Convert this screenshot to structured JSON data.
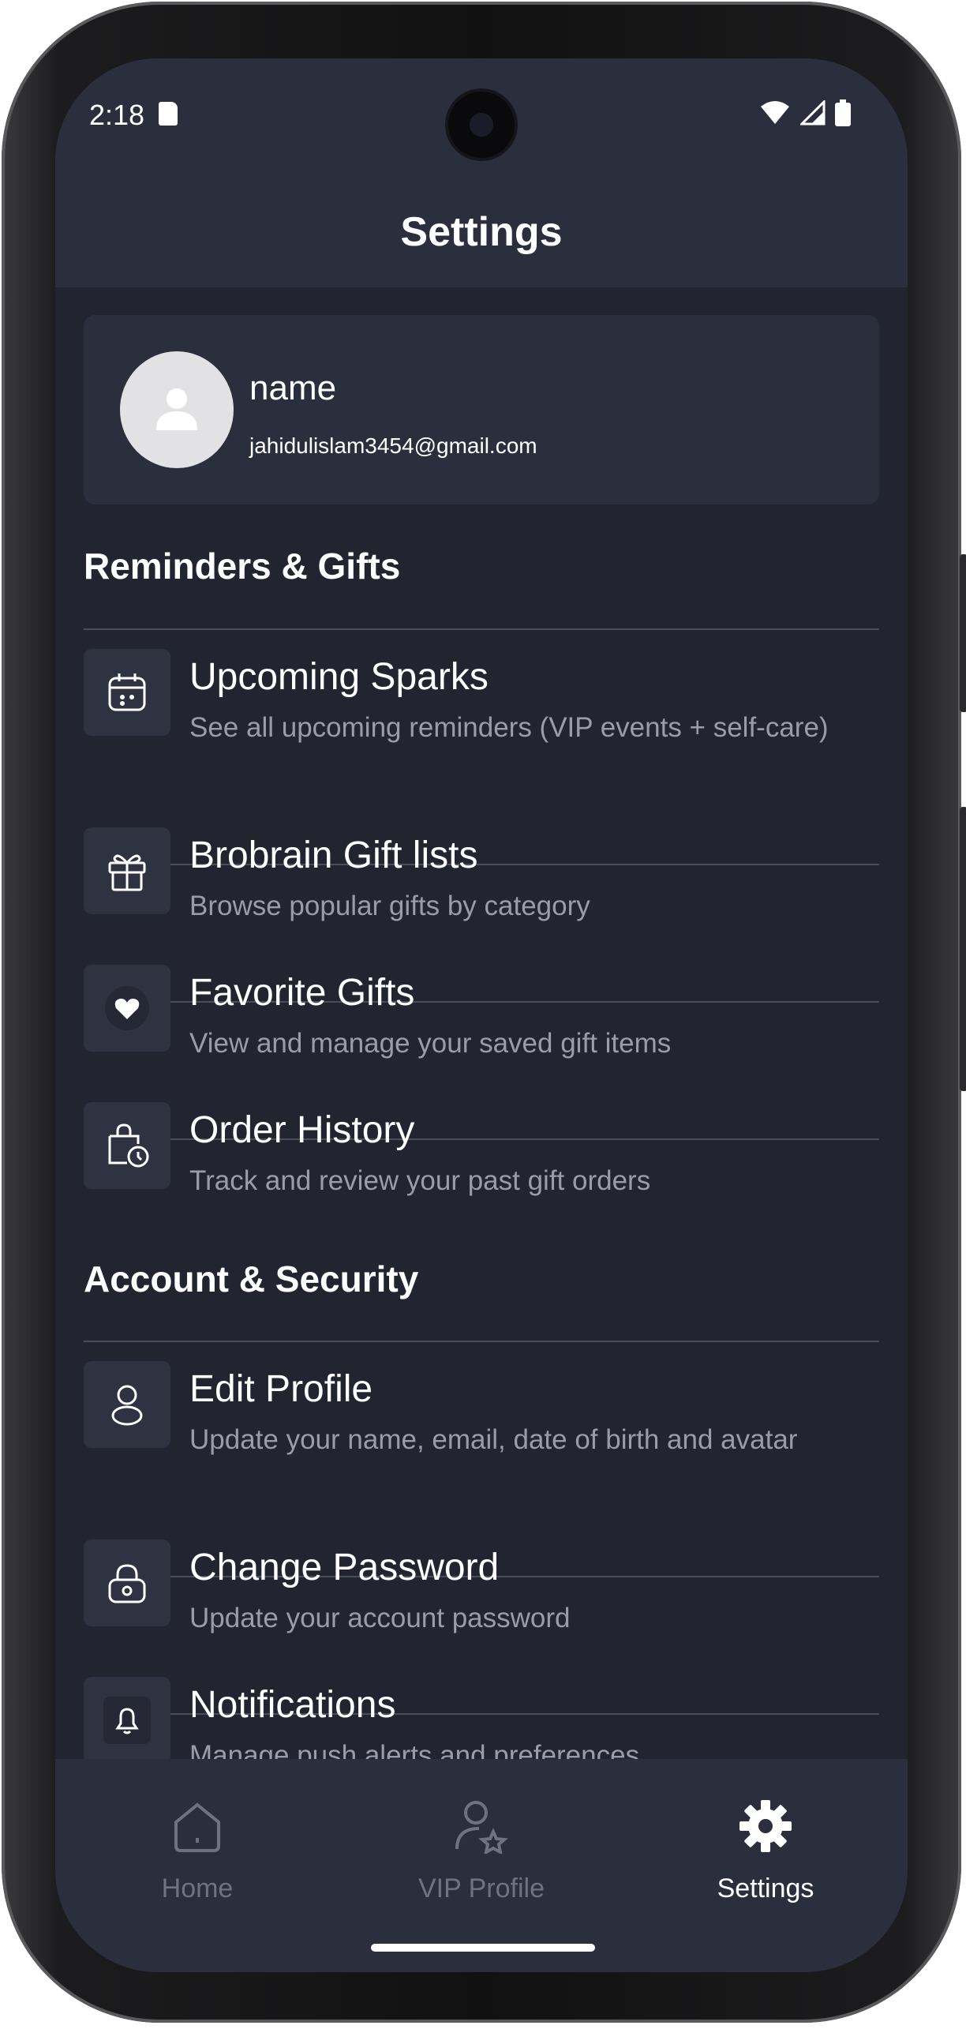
{
  "status_bar": {
    "time": "2:18"
  },
  "header": {
    "title": "Settings"
  },
  "profile": {
    "name": "name",
    "email": "jahidulislam3454@gmail.com"
  },
  "sections": [
    {
      "title": "Reminders & Gifts",
      "items": [
        {
          "title": "Upcoming Sparks",
          "subtitle": "See all upcoming reminders (VIP events + self-care)",
          "icon": "calendar-icon"
        },
        {
          "title": "Brobrain Gift lists",
          "subtitle": "Browse popular gifts by category",
          "icon": "gift-icon"
        },
        {
          "title": "Favorite Gifts",
          "subtitle": "View and manage your saved gift items",
          "icon": "heart-icon"
        },
        {
          "title": "Order History",
          "subtitle": "Track and review your past gift orders",
          "icon": "bag-clock-icon"
        }
      ]
    },
    {
      "title": "Account & Security",
      "items": [
        {
          "title": "Edit Profile",
          "subtitle": "Update your name, email, date of birth and avatar",
          "icon": "user-icon"
        },
        {
          "title": "Change Password",
          "subtitle": "Update your account password",
          "icon": "lock-icon"
        },
        {
          "title": "Notifications",
          "subtitle": "Manage push alerts and preferences",
          "icon": "bell-icon"
        }
      ]
    }
  ],
  "bottom_nav": {
    "items": [
      {
        "label": "Home",
        "icon": "home-icon",
        "active": false
      },
      {
        "label": "VIP Profile",
        "icon": "vip-user-star-icon",
        "active": false
      },
      {
        "label": "Settings",
        "icon": "gear-icon",
        "active": true
      }
    ]
  },
  "colors": {
    "background": "#22242f",
    "surface": "#2b2e3d",
    "text_primary": "#ffffff",
    "text_secondary": "#9a9da8",
    "nav_inactive": "#6f7280"
  }
}
